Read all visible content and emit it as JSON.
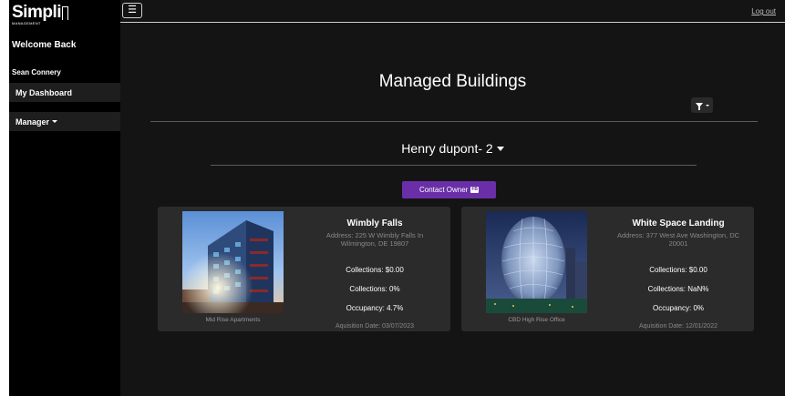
{
  "app": {
    "logo_text": "Simpli",
    "logo_subtitle": "MANAGEMENT"
  },
  "sidebar": {
    "welcome": "Welcome Back",
    "user_name": "Sean Connery",
    "items": [
      {
        "label": "My Dashboard"
      },
      {
        "label": "Manager"
      }
    ]
  },
  "topbar": {
    "menu_icon": "☰",
    "logout_label": "Log out"
  },
  "main": {
    "title": "Managed Buildings",
    "owner_selector": "Henry dupont- 2",
    "contact_button": "Contact Owner",
    "contact_badge": "FB",
    "colors": {
      "background": "#141414",
      "card": "#2b2b2b",
      "accent": "#6a2fa8"
    }
  },
  "buildings": [
    {
      "name": "Wimbly Falls",
      "address": "Address: 225 W Wimbly Falls In Wilmington, DE 19807",
      "collections_amount": "Collections: $0.00",
      "collections_percent": "Collections: 0%",
      "occupancy": "Occupancy: 4.7%",
      "acquisition_date": "Aquisition Date: 03/07/2023",
      "type": "Mid Rise Apartments"
    },
    {
      "name": "White Space Landing",
      "address": "Address: 377 West Ave Washington, DC 20001",
      "collections_amount": "Collections: $0.00",
      "collections_percent": "Collections: NaN%",
      "occupancy": "Occupancy: 0%",
      "acquisition_date": "Aquisition Date: 12/01/2022",
      "type": "CBD High Rise Office"
    }
  ]
}
